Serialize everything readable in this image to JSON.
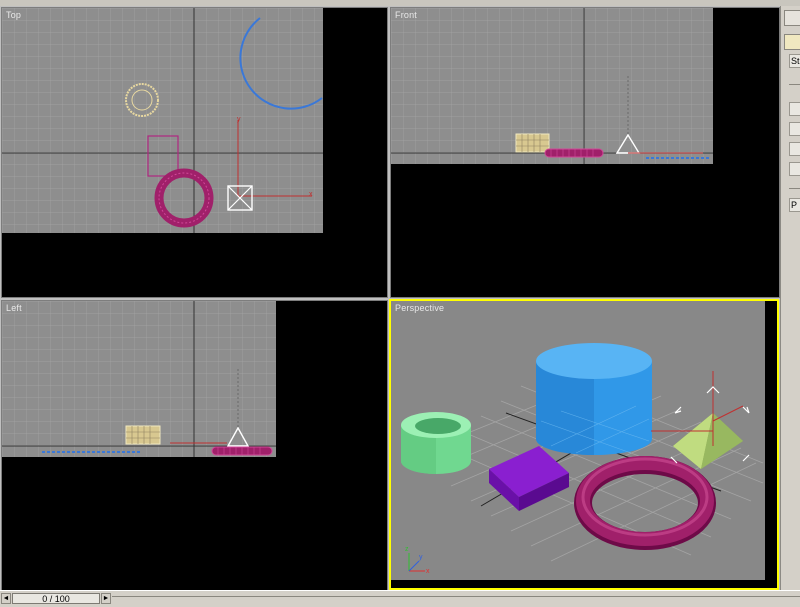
{
  "viewports": {
    "top": {
      "label": "Top"
    },
    "front": {
      "label": "Front"
    },
    "left": {
      "label": "Left"
    },
    "perspective": {
      "label": "Perspective"
    }
  },
  "command_panel": {
    "field1": "St",
    "field2": "P"
  },
  "time_slider": {
    "value": "0 / 100",
    "prev_glyph": "◄",
    "next_glyph": "►"
  },
  "colors": {
    "grid_bg": "#8e8e8e",
    "active_border": "#ffff00",
    "torus": "#a0206a",
    "cylinder": "#3aa0e8",
    "tube": "#80e8a0",
    "box": "#8a1fd0",
    "pyramid": "#a8c860",
    "wireframe_yellow": "#e8d8a0"
  }
}
